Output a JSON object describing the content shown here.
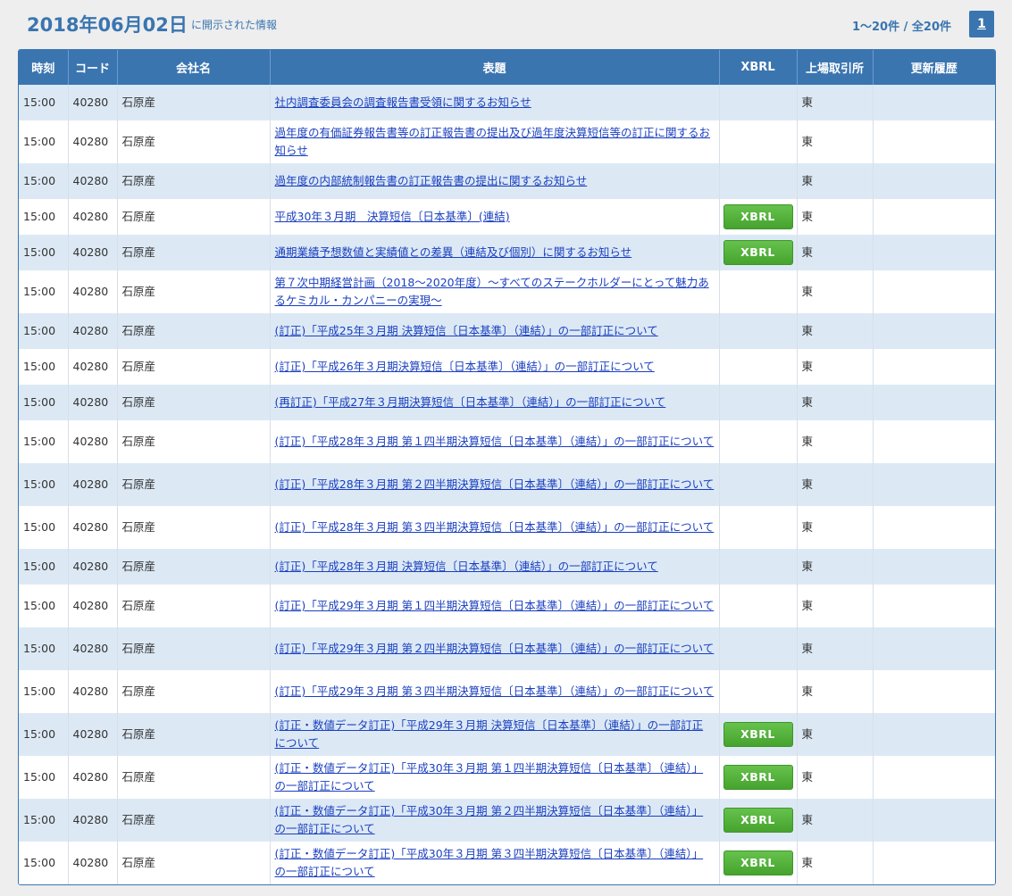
{
  "header": {
    "date": "2018年06月02日",
    "subtitle": "に開示された情報",
    "count": "1～20件 / 全20件",
    "page": "1"
  },
  "columns": [
    "時刻",
    "コード",
    "会社名",
    "表題",
    "XBRL",
    "上場取引所",
    "更新履歴"
  ],
  "xbrl_label": "XBRL",
  "rows": [
    {
      "time": "15:00",
      "code": "40280",
      "company": "石原産",
      "title": "社内調査委員会の調査報告書受領に関するお知らせ",
      "xbrl": false,
      "exchange": "東",
      "history": ""
    },
    {
      "time": "15:00",
      "code": "40280",
      "company": "石原産",
      "title": "過年度の有価証券報告書等の訂正報告書の提出及び過年度決算短信等の訂正に関するお知らせ",
      "xbrl": false,
      "exchange": "東",
      "history": ""
    },
    {
      "time": "15:00",
      "code": "40280",
      "company": "石原産",
      "title": "過年度の内部統制報告書の訂正報告書の提出に関するお知らせ",
      "xbrl": false,
      "exchange": "東",
      "history": ""
    },
    {
      "time": "15:00",
      "code": "40280",
      "company": "石原産",
      "title": "平成30年３月期　決算短信〔日本基準〕(連結)",
      "xbrl": true,
      "exchange": "東",
      "history": ""
    },
    {
      "time": "15:00",
      "code": "40280",
      "company": "石原産",
      "title": "通期業績予想数値と実績値との差異（連結及び個別）に関するお知らせ",
      "xbrl": true,
      "exchange": "東",
      "history": ""
    },
    {
      "time": "15:00",
      "code": "40280",
      "company": "石原産",
      "title": "第７次中期経営計画（2018～2020年度）～すべてのステークホルダーにとって魅力あるケミカル・カンパニーの実現～",
      "xbrl": false,
      "exchange": "東",
      "history": ""
    },
    {
      "time": "15:00",
      "code": "40280",
      "company": "石原産",
      "title": "(訂正)「平成25年３月期 決算短信〔日本基準〕（連結）」の一部訂正について",
      "xbrl": false,
      "exchange": "東",
      "history": ""
    },
    {
      "time": "15:00",
      "code": "40280",
      "company": "石原産",
      "title": "(訂正)「平成26年３月期決算短信〔日本基準〕（連結）」の一部訂正について",
      "xbrl": false,
      "exchange": "東",
      "history": ""
    },
    {
      "time": "15:00",
      "code": "40280",
      "company": "石原産",
      "title": "(再訂正)「平成27年３月期決算短信〔日本基準〕（連結）」の一部訂正について",
      "xbrl": false,
      "exchange": "東",
      "history": ""
    },
    {
      "time": "15:00",
      "code": "40280",
      "company": "石原産",
      "title": "(訂正)「平成28年３月期 第１四半期決算短信〔日本基準〕（連結）」の一部訂正について",
      "xbrl": false,
      "exchange": "東",
      "history": ""
    },
    {
      "time": "15:00",
      "code": "40280",
      "company": "石原産",
      "title": "(訂正)「平成28年３月期 第２四半期決算短信〔日本基準〕（連結）」の一部訂正について",
      "xbrl": false,
      "exchange": "東",
      "history": ""
    },
    {
      "time": "15:00",
      "code": "40280",
      "company": "石原産",
      "title": "(訂正)「平成28年３月期 第３四半期決算短信〔日本基準〕（連結）」の一部訂正について",
      "xbrl": false,
      "exchange": "東",
      "history": ""
    },
    {
      "time": "15:00",
      "code": "40280",
      "company": "石原産",
      "title": "(訂正)「平成28年３月期 決算短信〔日本基準〕（連結）」の一部訂正について",
      "xbrl": false,
      "exchange": "東",
      "history": ""
    },
    {
      "time": "15:00",
      "code": "40280",
      "company": "石原産",
      "title": "(訂正)「平成29年３月期 第１四半期決算短信〔日本基準〕（連結）」の一部訂正について",
      "xbrl": false,
      "exchange": "東",
      "history": ""
    },
    {
      "time": "15:00",
      "code": "40280",
      "company": "石原産",
      "title": "(訂正)「平成29年３月期 第２四半期決算短信〔日本基準〕（連結）」の一部訂正について",
      "xbrl": false,
      "exchange": "東",
      "history": ""
    },
    {
      "time": "15:00",
      "code": "40280",
      "company": "石原産",
      "title": "(訂正)「平成29年３月期 第３四半期決算短信〔日本基準〕（連結）」の一部訂正について",
      "xbrl": false,
      "exchange": "東",
      "history": ""
    },
    {
      "time": "15:00",
      "code": "40280",
      "company": "石原産",
      "title": "(訂正・数値データ訂正)「平成29年３月期 決算短信〔日本基準〕（連結）」の一部訂正について",
      "xbrl": true,
      "exchange": "東",
      "history": ""
    },
    {
      "time": "15:00",
      "code": "40280",
      "company": "石原産",
      "title": "(訂正・数値データ訂正)「平成30年３月期 第１四半期決算短信〔日本基準〕（連結）」の一部訂正について",
      "xbrl": true,
      "exchange": "東",
      "history": ""
    },
    {
      "time": "15:00",
      "code": "40280",
      "company": "石原産",
      "title": "(訂正・数値データ訂正)「平成30年３月期 第２四半期決算短信〔日本基準〕（連結）」の一部訂正について",
      "xbrl": true,
      "exchange": "東",
      "history": ""
    },
    {
      "time": "15:00",
      "code": "40280",
      "company": "石原産",
      "title": "(訂正・数値データ訂正)「平成30年３月期 第３四半期決算短信〔日本基準〕（連結）」の一部訂正について",
      "xbrl": true,
      "exchange": "東",
      "history": ""
    }
  ]
}
